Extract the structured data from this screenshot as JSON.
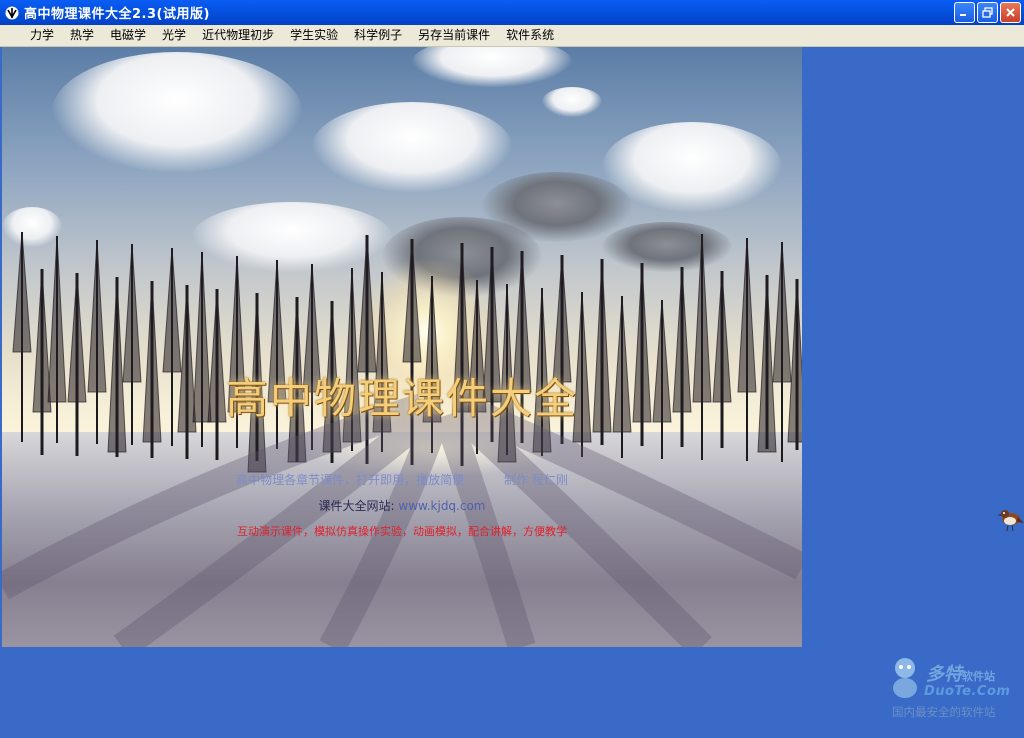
{
  "window": {
    "title": "高中物理课件大全2.3(试用版)"
  },
  "menu": {
    "items": [
      "力学",
      "热学",
      "电磁学",
      "光学",
      "近代物理初步",
      "学生实验",
      "科学例子",
      "另存当前课件",
      "软件系统"
    ]
  },
  "splash": {
    "headline": "高中物理课件大全",
    "line1_left": "高中物理各章节课件，打开即用，播放简便",
    "line1_right": "制作 程仁刚",
    "line2_label": "课件大全网站:",
    "line2_site": "www.kjdq.com",
    "line3": "互动演示课件，模拟仿真操作实验，动画模拟，配合讲解，方便教学"
  },
  "watermark": {
    "brand": "多特",
    "brand_suffix": "软件站",
    "domain": "DuoTe.Com",
    "slogan": "国内最安全的软件站"
  },
  "icons": {
    "app": "app-logo-icon",
    "minimize": "minimize-icon",
    "maximize": "maximize-icon",
    "close": "close-icon",
    "bird": "bird-icon",
    "mascot": "mascot-icon"
  },
  "colors": {
    "titlebar": "#0553E2",
    "desktop": "#3A6AC8",
    "menubar": "#ECE9D8",
    "headline": "#F4CE7A",
    "red_text": "#E0202A"
  }
}
